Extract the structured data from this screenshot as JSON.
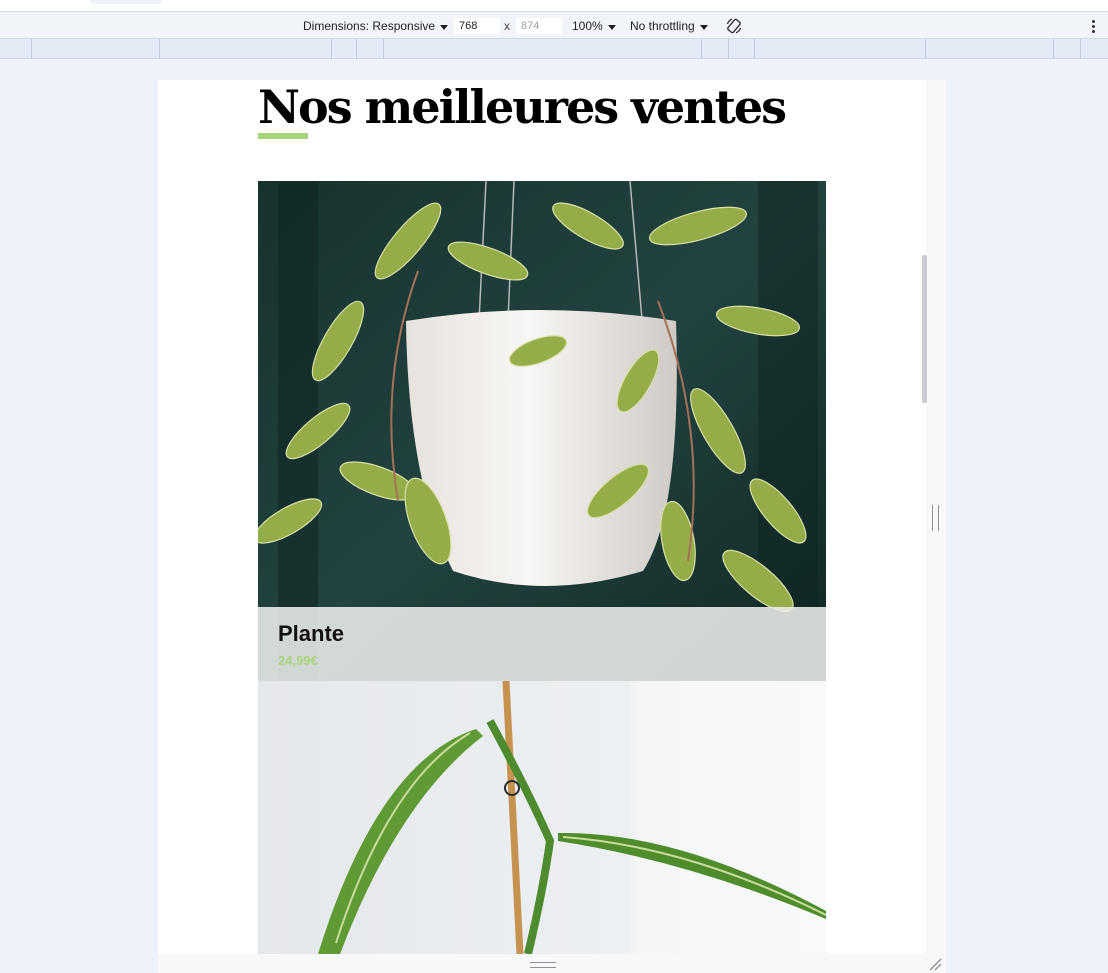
{
  "devtools": {
    "toolbar": {
      "dimensions_label": "Dimensions: Responsive",
      "width_value": "768",
      "height_placeholder": "874",
      "times_symbol": "x",
      "zoom_label": "100%",
      "throttling_label": "No throttling",
      "rotate_icon": "rotate-icon",
      "more_icon": "kebab-menu-icon"
    }
  },
  "page": {
    "title": "Nos meilleures ventes",
    "accent_color": "#a8d47a",
    "products": [
      {
        "name": "Plante",
        "price": "24,99€"
      }
    ]
  }
}
